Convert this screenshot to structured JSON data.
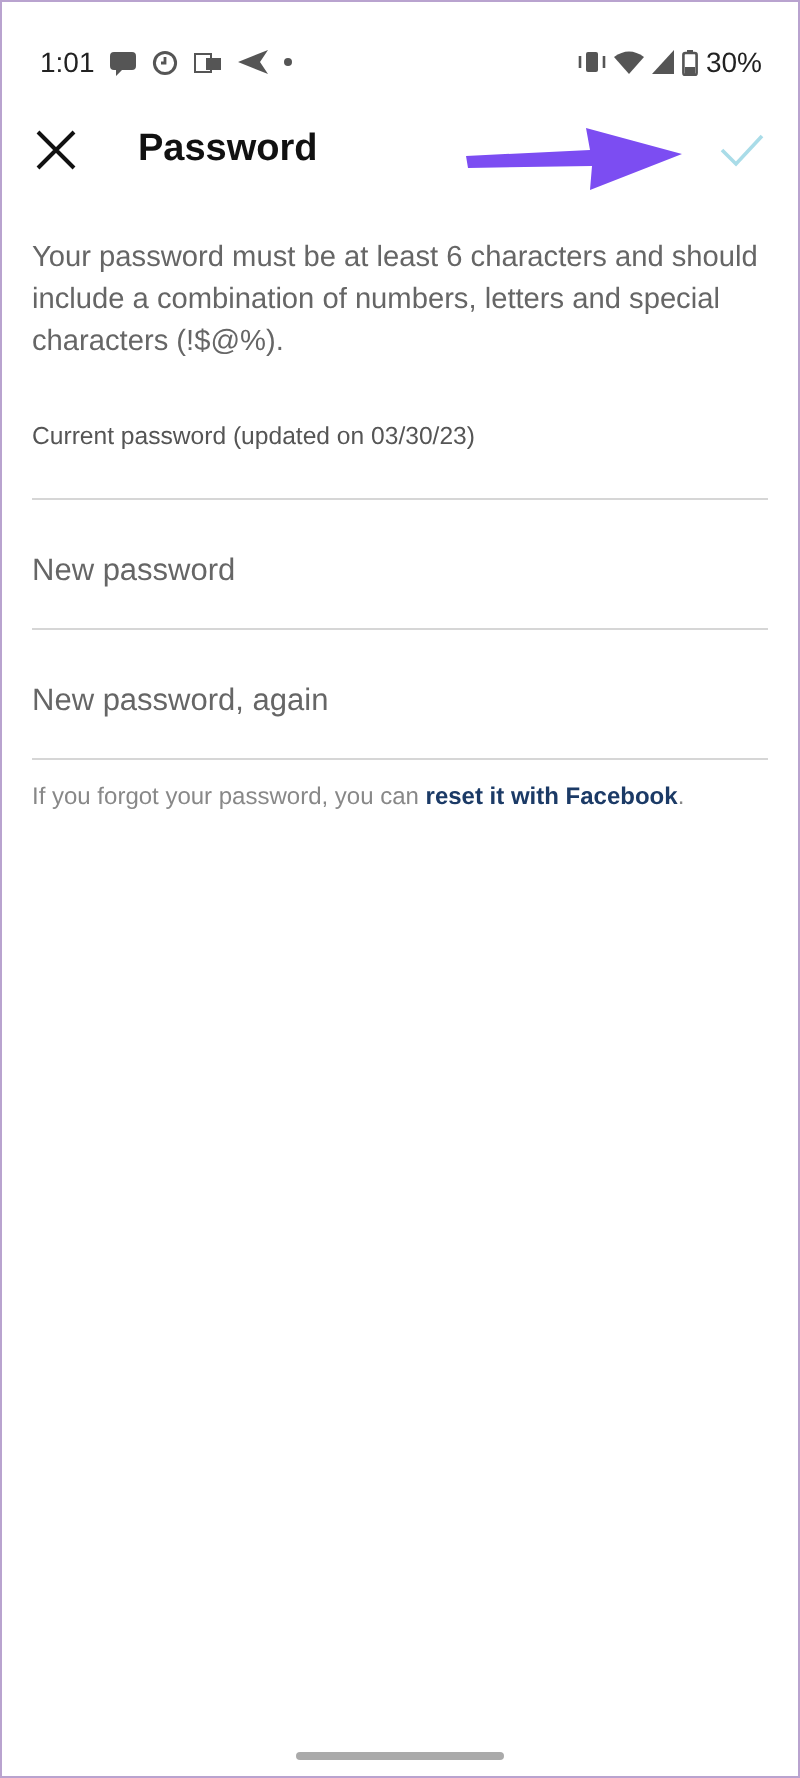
{
  "status_bar": {
    "time": "1:01",
    "battery": "30%"
  },
  "header": {
    "title": "Password",
    "confirm": {
      "disabled": true
    }
  },
  "annotations": [
    {
      "kind": "arrow"
    }
  ],
  "description": "Your password must be at least 6 characters and should include a combination of numbers, letters and special characters (!$@%).",
  "fields": [
    {
      "label": "Current password (updated on 03/30/23)"
    },
    {
      "placeholder": "New password"
    },
    {
      "placeholder": "New password, again"
    }
  ],
  "footer": {
    "text_before": "If you forgot your password, you can ",
    "link": "reset it with Facebook",
    "text_after": "."
  }
}
